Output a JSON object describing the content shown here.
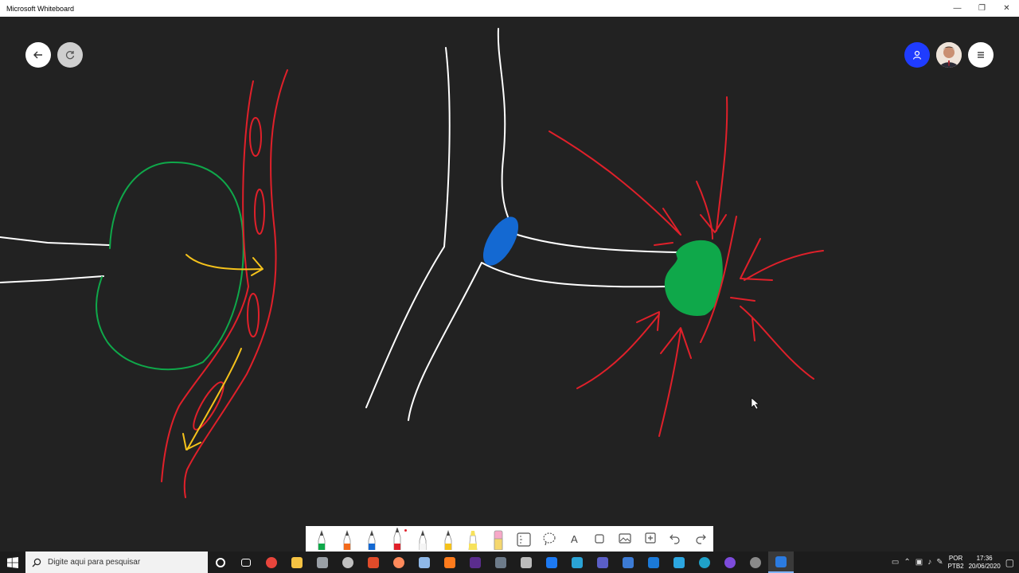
{
  "window": {
    "title": "Microsoft Whiteboard",
    "controls": {
      "minimize": "—",
      "restore": "❐",
      "close": "✕"
    }
  },
  "canvas_buttons": {
    "back_icon": "arrow-left",
    "sync_icon": "sync",
    "invite_icon": "person",
    "avatar_icon": "user-avatar",
    "menu_icon": "hamburger"
  },
  "colors": {
    "canvas_bg": "#222222",
    "ink_white": "#ffffff",
    "ink_red": "#e0202a",
    "ink_green": "#0fa84a",
    "ink_yellow": "#f5c21b",
    "ink_blue": "#1469d2",
    "invite_blue": "#1f3cff"
  },
  "toolbar": {
    "tools": [
      {
        "name": "pen-green",
        "color": "#0fa84a"
      },
      {
        "name": "pen-orange",
        "color": "#f26a1b"
      },
      {
        "name": "pen-blue",
        "color": "#1469d2"
      },
      {
        "name": "pen-red",
        "color": "#e0202a",
        "active": true
      },
      {
        "name": "pen-white",
        "color": "#f5f5f5"
      },
      {
        "name": "pen-yellow",
        "color": "#f5c21b"
      },
      {
        "name": "highlighter-yellow",
        "color": "#f7e25c"
      },
      {
        "name": "eraser",
        "color": "#f7a8c8"
      }
    ],
    "ruler_icon": "ruler",
    "lasso_icon": "lasso",
    "text_label": "A",
    "shape_icon": "shape",
    "image_icon": "image",
    "add_icon": "add",
    "undo_icon": "undo",
    "redo_icon": "redo"
  },
  "taskbar": {
    "search_placeholder": "Digite aqui para pesquisar",
    "language_line1": "POR",
    "language_line2": "PTB2",
    "time": "17:36",
    "date": "20/06/2020",
    "apps": [
      {
        "name": "cortana",
        "color": "#ffffff"
      },
      {
        "name": "task-view",
        "color": "#ffffff"
      },
      {
        "name": "chrome",
        "color": "#e8453c"
      },
      {
        "name": "file-explorer",
        "color": "#f6c343"
      },
      {
        "name": "app-1",
        "color": "#9aa0a6"
      },
      {
        "name": "app-2",
        "color": "#c0c0c0"
      },
      {
        "name": "app-3",
        "color": "#e04b2a"
      },
      {
        "name": "app-4",
        "color": "#ff8a5b"
      },
      {
        "name": "app-5",
        "color": "#8fb8e8"
      },
      {
        "name": "app-6",
        "color": "#ff7b1c"
      },
      {
        "name": "premiere",
        "color": "#5b2d8e"
      },
      {
        "name": "camera",
        "color": "#6d7b8a"
      },
      {
        "name": "calculator",
        "color": "#bbbbbb"
      },
      {
        "name": "dropbox",
        "color": "#1d7af3"
      },
      {
        "name": "app-7",
        "color": "#2aa3d6"
      },
      {
        "name": "teams",
        "color": "#5b5fc7"
      },
      {
        "name": "app-8",
        "color": "#3c7bd5"
      },
      {
        "name": "app-9",
        "color": "#1b7ad9"
      },
      {
        "name": "app-10",
        "color": "#2ca6e0"
      },
      {
        "name": "edge",
        "color": "#1fa1c9"
      },
      {
        "name": "app-11",
        "color": "#7d4bdb"
      },
      {
        "name": "app-12",
        "color": "#8a8a8a"
      },
      {
        "name": "whiteboard",
        "color": "#2b7be0",
        "running": true
      }
    ]
  }
}
